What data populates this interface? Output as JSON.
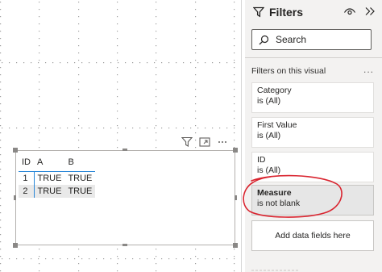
{
  "visual_table": {
    "headers": [
      "ID",
      "A",
      "B"
    ],
    "rows": [
      [
        "1",
        "TRUE",
        "TRUE"
      ],
      [
        "2",
        "TRUE",
        "TRUE"
      ]
    ]
  },
  "visual_header_icons": [
    "filter-icon",
    "focus-mode-icon",
    "more-options-icon"
  ],
  "filters_pane": {
    "title": "Filters",
    "search_placeholder": "Search",
    "section_label": "Filters on this visual",
    "more_label": "...",
    "cards": [
      {
        "name": "Category",
        "state": "is (All)"
      },
      {
        "name": "First Value",
        "state": "is (All)"
      },
      {
        "name": "ID",
        "state": "is (All)"
      },
      {
        "name": "Measure",
        "state": "is not blank"
      }
    ],
    "add_fields_label": "Add data fields here"
  },
  "colors": {
    "accent_blue": "#2b88d8",
    "annotation_red": "#d9242f",
    "pane_bg": "#f3f2f1"
  }
}
